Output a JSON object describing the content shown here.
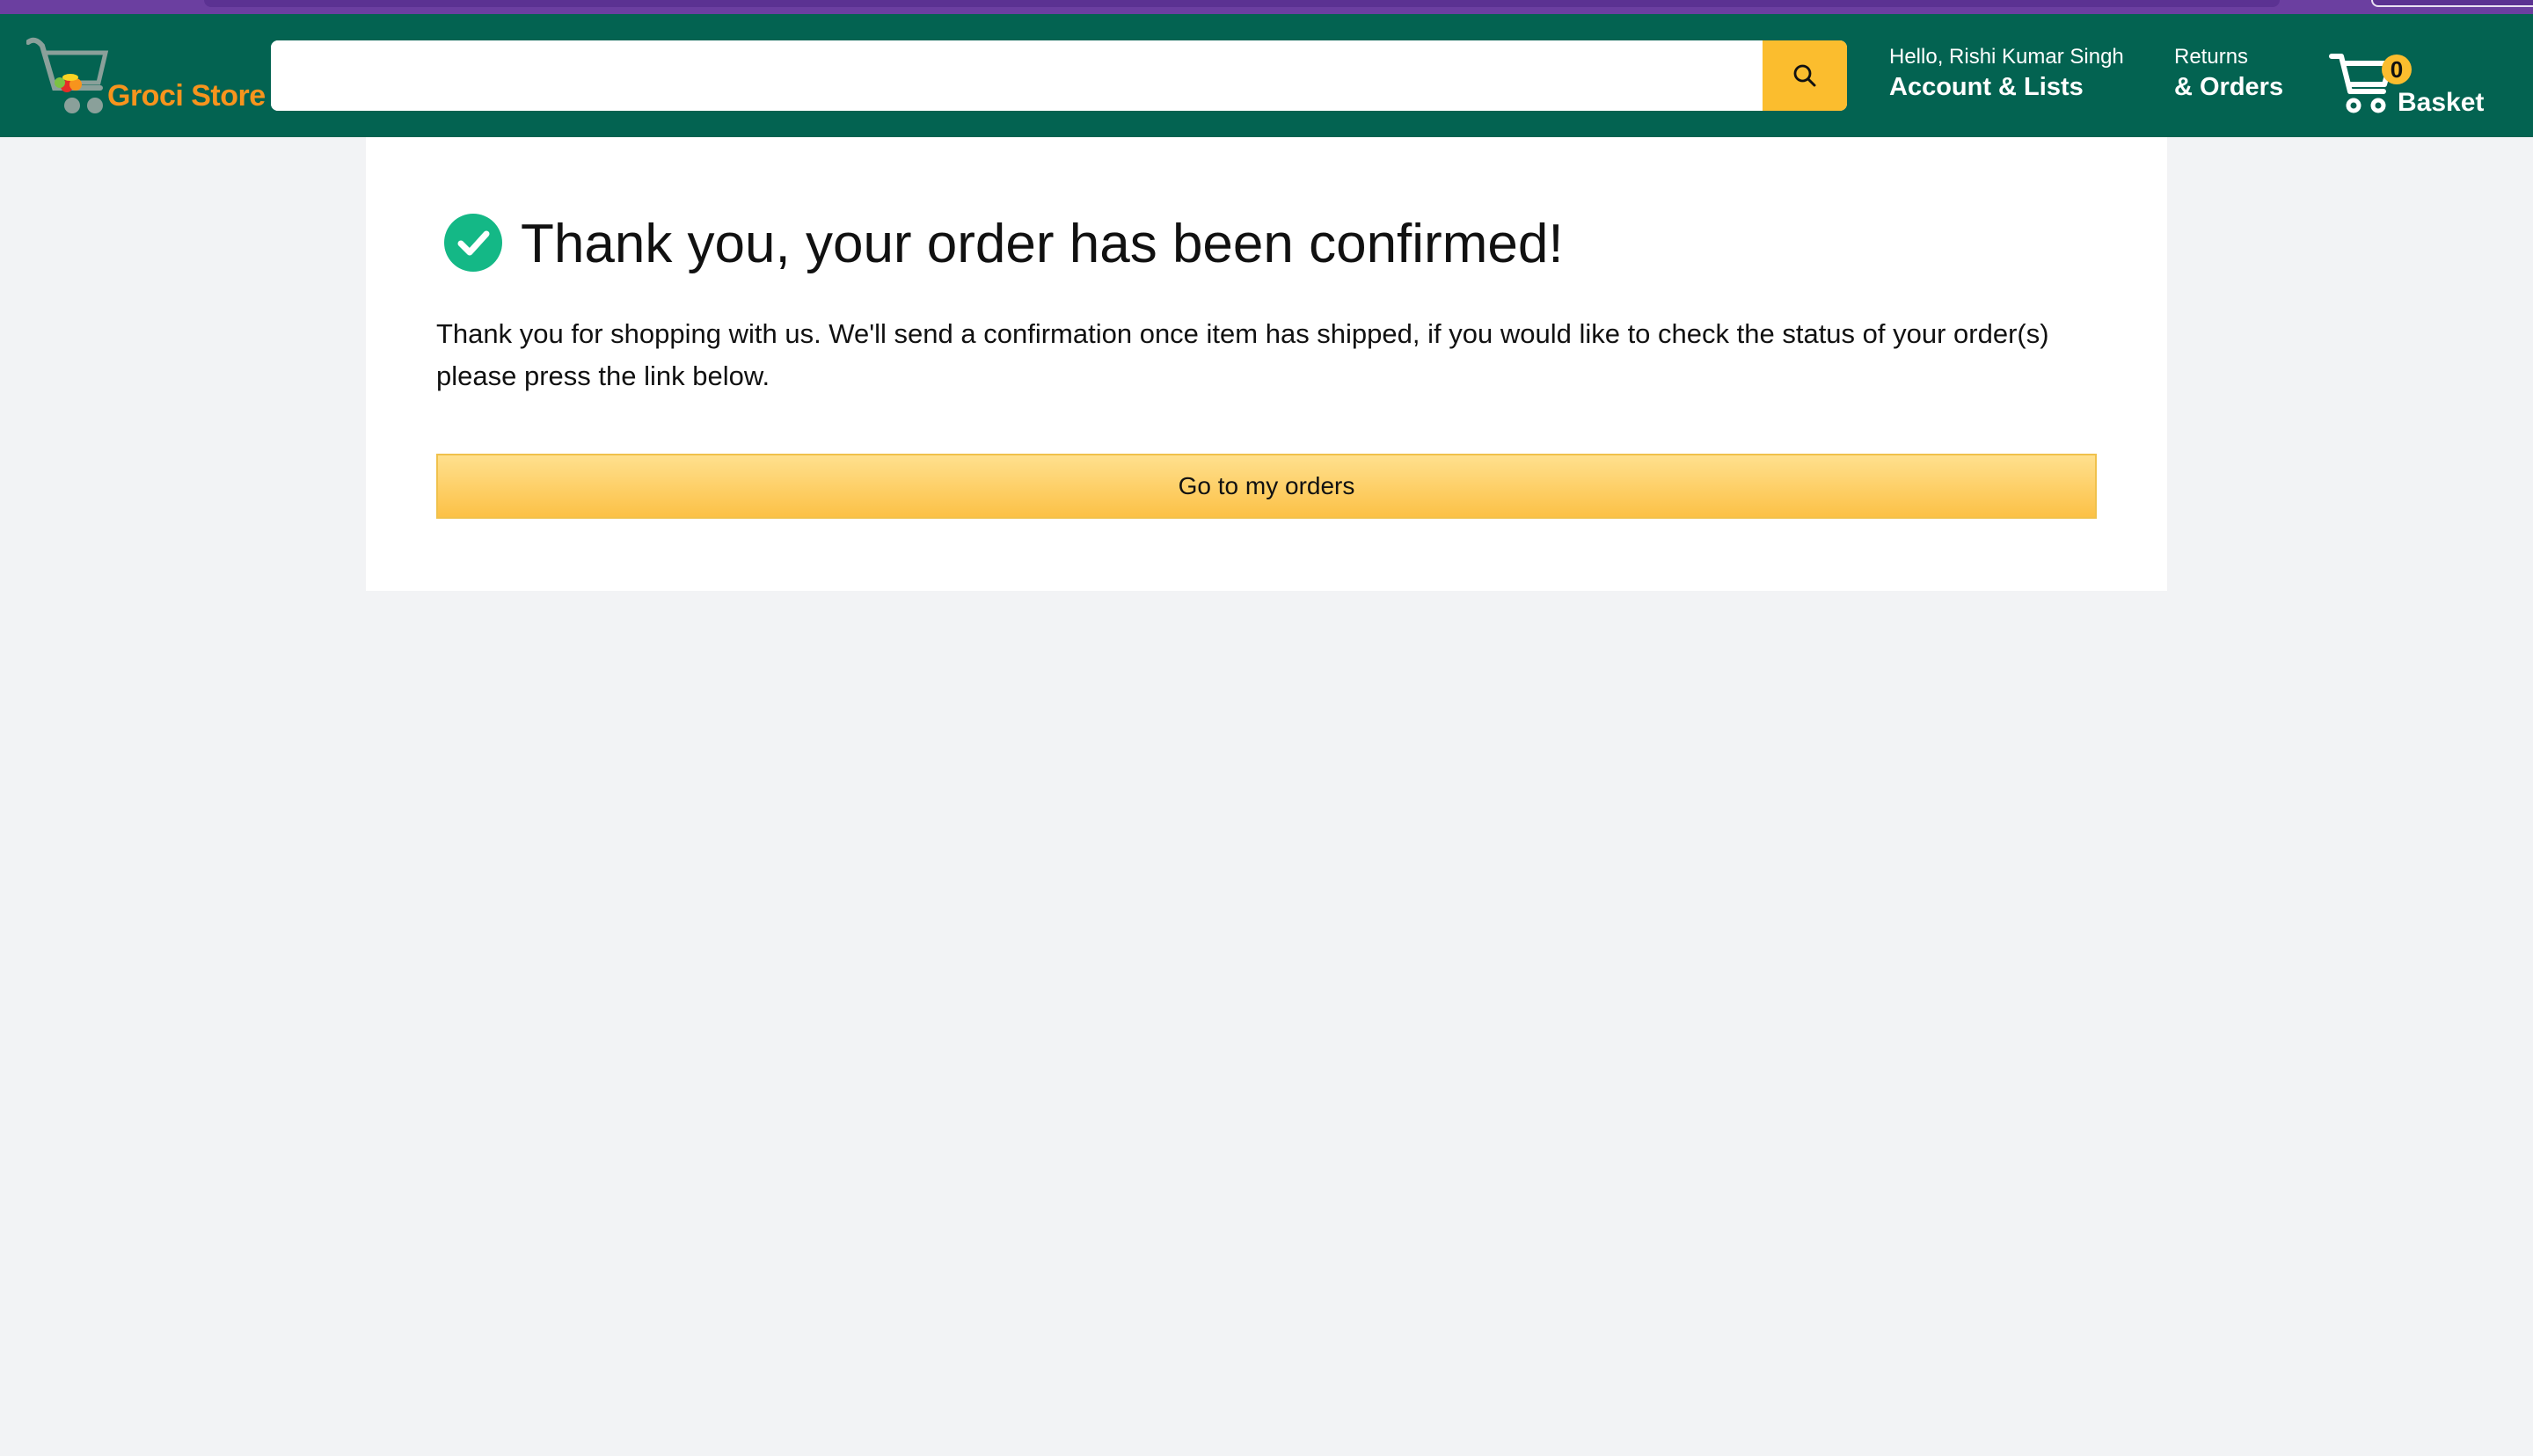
{
  "header": {
    "logo_text": "Groci Store",
    "search": {
      "value": "",
      "placeholder": ""
    },
    "account": {
      "greeting": "Hello, Rishi Kumar Singh",
      "label": "Account & Lists"
    },
    "returns": {
      "line1": "Returns",
      "line2": "& Orders"
    },
    "basket": {
      "count": "0",
      "label": "Basket"
    }
  },
  "confirmation": {
    "title": "Thank you, your order has been confirmed!",
    "message": "Thank you for shopping with us. We'll send a confirmation once item has shipped, if you would like to check the status of your order(s) please press the link below.",
    "button_label": "Go to my orders"
  },
  "icons": {
    "logo": "cart-logo-icon",
    "search": "search-icon",
    "basket": "cart-icon",
    "success": "check-circle-icon"
  },
  "colors": {
    "header_bg": "#036351",
    "top_strip": "#6b3fa0",
    "accent": "#fbbd2e",
    "logo_text": "#f7941d",
    "success": "#14b886",
    "page_bg": "#f2f3f5"
  }
}
